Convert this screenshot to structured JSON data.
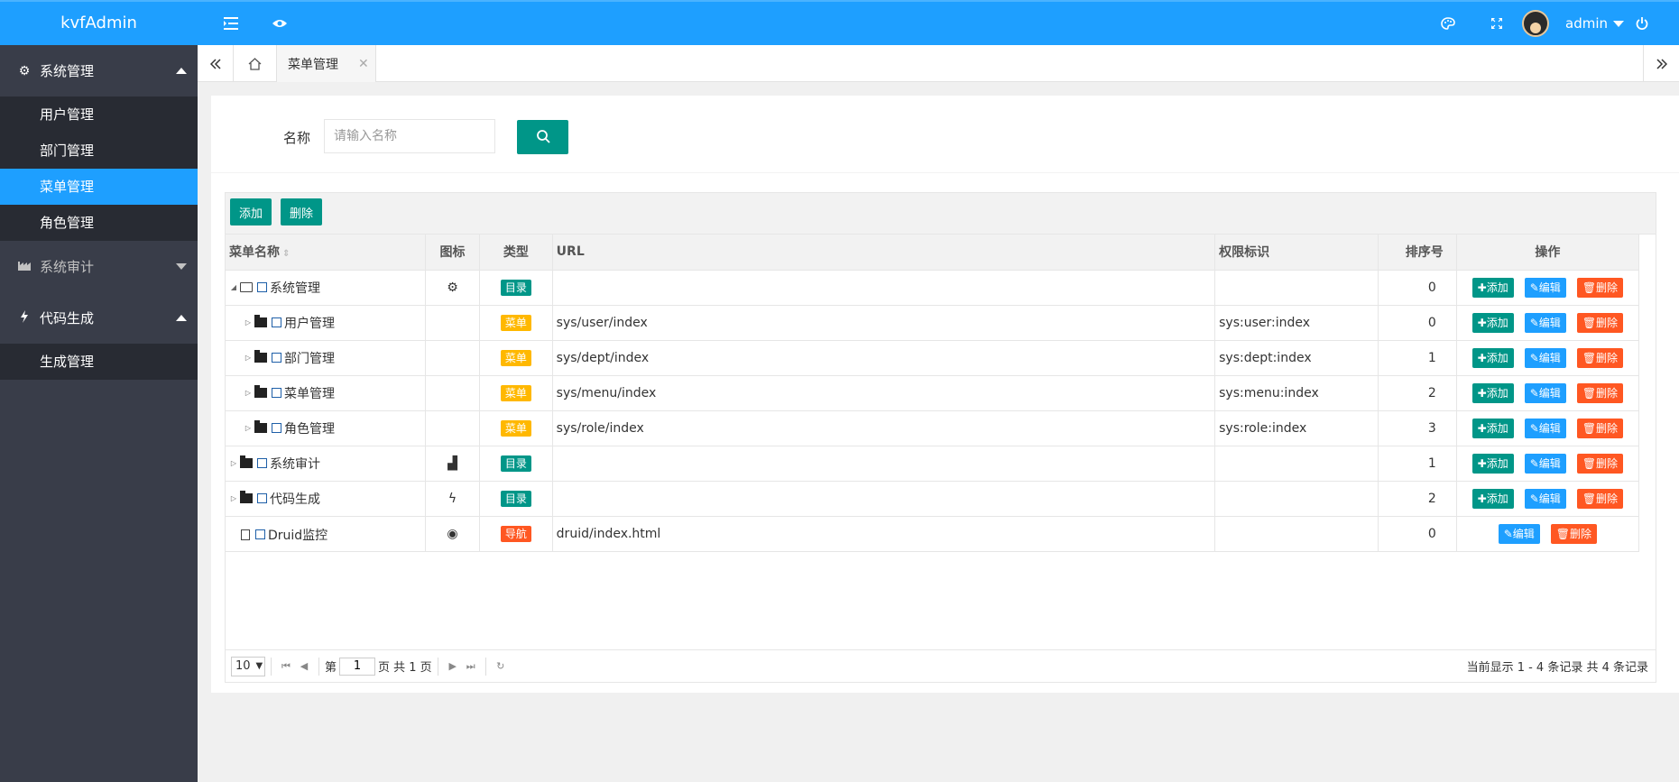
{
  "app": {
    "title": "kvfAdmin"
  },
  "header": {
    "user": "admin"
  },
  "sidebar": {
    "groups": [
      {
        "label": "系统管理",
        "expanded": true,
        "items": [
          "用户管理",
          "部门管理",
          "菜单管理",
          "角色管理"
        ],
        "active": "菜单管理"
      },
      {
        "label": "系统审计",
        "expanded": false,
        "items": []
      },
      {
        "label": "代码生成",
        "expanded": true,
        "items": [
          "生成管理"
        ]
      }
    ]
  },
  "tabs": {
    "active": "菜单管理"
  },
  "search": {
    "label": "名称",
    "placeholder": "请输入名称"
  },
  "toolbar": {
    "add": "添加",
    "delete": "删除"
  },
  "table": {
    "columns": [
      "菜单名称",
      "图标",
      "类型",
      "URL",
      "权限标识",
      "排序号",
      "操作"
    ],
    "actions": {
      "add": "添加",
      "edit": "编辑",
      "delete": "删除"
    },
    "rows": [
      {
        "name": "系统管理",
        "level": 0,
        "expanded": true,
        "node": "folder-open",
        "icon": "gears-icon",
        "icon_char": "⚙",
        "type": "目录",
        "type_color": "#009688",
        "url": "",
        "perm": "",
        "sort": "0",
        "has_add": true
      },
      {
        "name": "用户管理",
        "level": 1,
        "expanded": false,
        "node": "folder",
        "icon": "",
        "icon_char": "",
        "type": "菜单",
        "type_color": "#ffb800",
        "url": "sys/user/index",
        "perm": "sys:user:index",
        "sort": "0",
        "has_add": true
      },
      {
        "name": "部门管理",
        "level": 1,
        "expanded": false,
        "node": "folder",
        "icon": "",
        "icon_char": "",
        "type": "菜单",
        "type_color": "#ffb800",
        "url": "sys/dept/index",
        "perm": "sys:dept:index",
        "sort": "1",
        "has_add": true
      },
      {
        "name": "菜单管理",
        "level": 1,
        "expanded": false,
        "node": "folder",
        "icon": "",
        "icon_char": "",
        "type": "菜单",
        "type_color": "#ffb800",
        "url": "sys/menu/index",
        "perm": "sys:menu:index",
        "sort": "2",
        "has_add": true
      },
      {
        "name": "角色管理",
        "level": 1,
        "expanded": false,
        "node": "folder",
        "icon": "",
        "icon_char": "",
        "type": "菜单",
        "type_color": "#ffb800",
        "url": "sys/role/index",
        "perm": "sys:role:index",
        "sort": "3",
        "has_add": true
      },
      {
        "name": "系统审计",
        "level": 0,
        "expanded": false,
        "node": "folder",
        "icon": "factory-icon",
        "icon_char": "▟",
        "type": "目录",
        "type_color": "#009688",
        "url": "",
        "perm": "",
        "sort": "1",
        "has_add": true
      },
      {
        "name": "代码生成",
        "level": 0,
        "expanded": false,
        "node": "folder",
        "icon": "bolt-icon",
        "icon_char": "ϟ",
        "type": "目录",
        "type_color": "#009688",
        "url": "",
        "perm": "",
        "sort": "2",
        "has_add": true
      },
      {
        "name": "Druid监控",
        "level": 0,
        "expanded": null,
        "node": "file",
        "icon": "eye-icon",
        "icon_char": "◉",
        "type": "导航",
        "type_color": "#ff5722",
        "url": "druid/index.html",
        "perm": "",
        "sort": "0",
        "has_add": false
      }
    ]
  },
  "pager": {
    "page_size": "10",
    "page_label_pre": "第",
    "page": "1",
    "page_label_post": "页 共 1 页",
    "info": "当前显示 1 - 4 条记录 共 4 条记录"
  }
}
